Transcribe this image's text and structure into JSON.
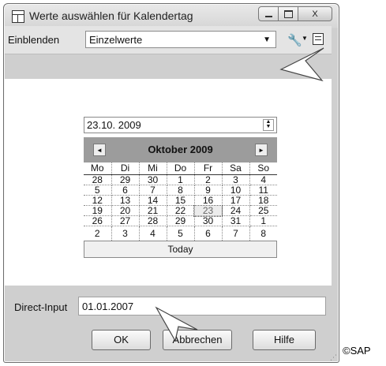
{
  "window": {
    "title": "Werte auswählen für Kalendertag",
    "close_glyph": "X"
  },
  "toolbar": {
    "show_label": "Einblenden",
    "show_value": "Einzelwerte",
    "dropdown_glyph": "▼",
    "tools_glyph": "🔧",
    "tools_dropdown_glyph": "▼"
  },
  "date_field": {
    "value": "23.10. 2009"
  },
  "calendar": {
    "month": "Oktober 2009",
    "prev_glyph": "◄",
    "next_glyph": "►",
    "weekdays": [
      "Mo",
      "Di",
      "Mi",
      "Do",
      "Fr",
      "Sa",
      "So"
    ],
    "weeks": [
      [
        "28",
        "29",
        "30",
        "1",
        "2",
        "3",
        "4"
      ],
      [
        "5",
        "6",
        "7",
        "8",
        "9",
        "10",
        "11"
      ],
      [
        "12",
        "13",
        "14",
        "15",
        "16",
        "17",
        "18"
      ],
      [
        "19",
        "20",
        "21",
        "22",
        "23",
        "24",
        "25"
      ],
      [
        "26",
        "27",
        "28",
        "29",
        "30",
        "31",
        "1"
      ],
      [
        "2",
        "3",
        "4",
        "5",
        "6",
        "7",
        "8"
      ]
    ],
    "selected_day": "23",
    "today_label": "Today"
  },
  "direct_input": {
    "label": "Direct-Input",
    "value": "01.01.2007"
  },
  "buttons": {
    "ok": "OK",
    "cancel": "Abbrechen",
    "help": "Hilfe"
  },
  "copyright": "©SAP"
}
